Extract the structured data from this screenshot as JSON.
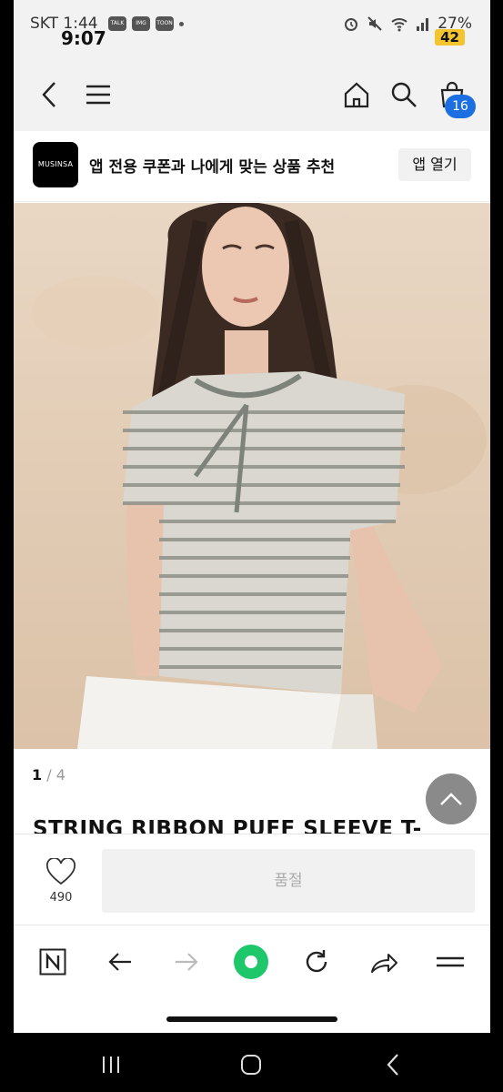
{
  "status": {
    "carrier": "SKT 1:44",
    "time": "9:07",
    "mini_icons": [
      "TALK",
      "IMG",
      "TOON"
    ],
    "battery_pct": "27%",
    "battery_badge": "42"
  },
  "header": {
    "cart_count": "16"
  },
  "banner": {
    "logo": "MUSINSA",
    "text": "앱 전용 쿠폰과 나에게 맞는 상품 추천",
    "open_label": "앱 열기"
  },
  "gallery": {
    "current": "1",
    "separator": " / ",
    "total": "4"
  },
  "product": {
    "title": "STRING RIBBON PUFF SLEEVE T-"
  },
  "buy": {
    "like_count": "490",
    "soldout_label": "품절"
  },
  "colors": {
    "accent": "#1b6fe0",
    "toolbar_green": "#1ec86a",
    "scroll_btn": "#8a8a8a"
  }
}
